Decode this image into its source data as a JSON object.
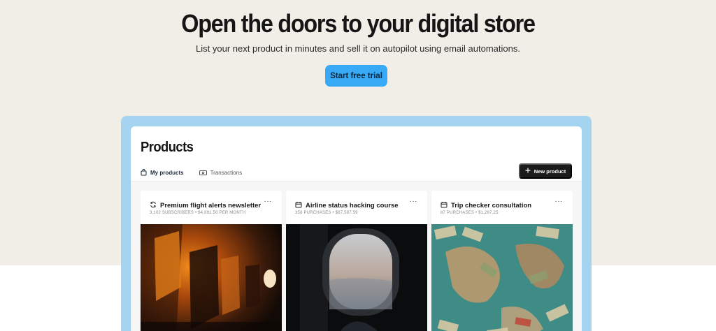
{
  "hero": {
    "title": "Open the doors to your digital store",
    "subtitle": "List your next product in minutes and sell it on autopilot using email automations.",
    "cta_label": "Start free trial"
  },
  "app": {
    "title": "Products",
    "tabs": [
      {
        "label": "My products",
        "icon": "shopping-bag-icon",
        "active": true
      },
      {
        "label": "Transactions",
        "icon": "banknote-icon",
        "active": false
      }
    ],
    "new_product_label": "New product",
    "new_product_icon": "plus-icon",
    "products": [
      {
        "title": "Premium flight alerts newsletter",
        "icon": "recurring-icon",
        "meta": "3,102 SUBSCRIBERS • $4,691.50 PER MONTH",
        "more": "···",
        "image": "airplane cabin with orange light"
      },
      {
        "title": "Airline status hacking course",
        "icon": "calendar-icon",
        "meta": "358 PURCHASES • $67,587.59",
        "more": "···",
        "image": "airplane window view"
      },
      {
        "title": "Trip checker consultation",
        "icon": "calendar-icon",
        "meta": "87 PURCHASES • $1,287.25",
        "more": "···",
        "image": "world map with banknotes"
      }
    ]
  },
  "colors": {
    "hero_bg": "#f1eee8",
    "cta": "#37a9f5",
    "frame": "#a5d4f1",
    "new_product_bg": "#1b1b1b"
  }
}
